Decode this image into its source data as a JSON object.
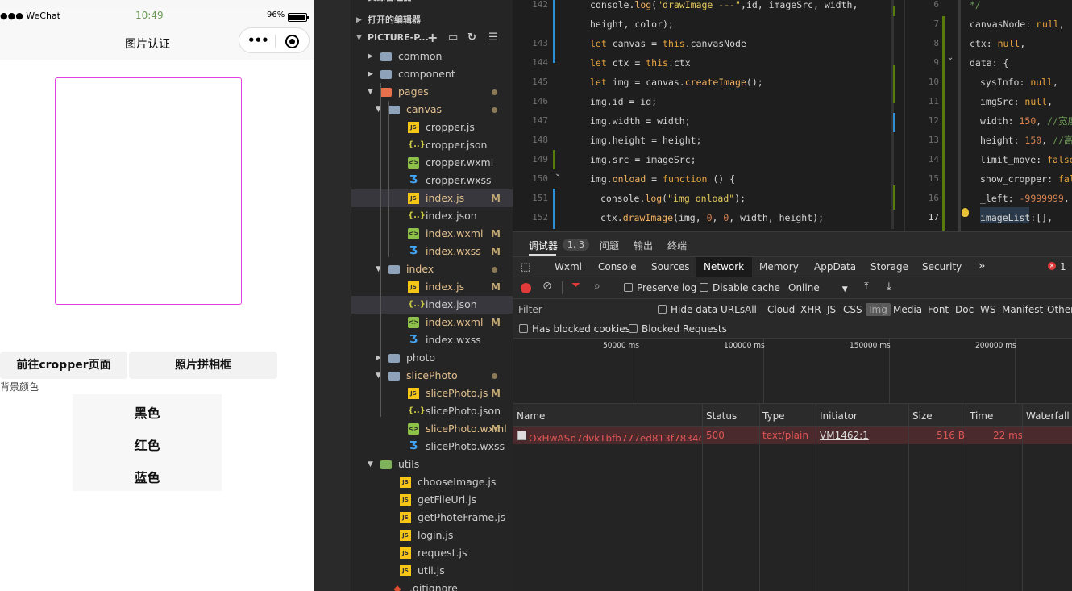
{
  "simulator": {
    "status_left": "●●● WeChat",
    "time": "10:49",
    "battery": "96%",
    "nav_title": "图片认证",
    "capsule_dots": "•••",
    "buttons": [
      "前往cropper页面",
      "照片拼相框"
    ],
    "bg_label": "背景颜色",
    "colors": [
      "黑色",
      "红色",
      "蓝色"
    ]
  },
  "explorer": {
    "header_partial": "资源管理器",
    "open_editors": "打开的编辑器",
    "project": "PICTURE-P...",
    "action_icons": [
      "add-file-icon",
      "add-folder-icon",
      "refresh-icon",
      "collapse-icon"
    ],
    "tree": [
      {
        "name": "common",
        "kind": "folder",
        "depth": 1,
        "open": false
      },
      {
        "name": "component",
        "kind": "folder",
        "depth": 1,
        "open": false
      },
      {
        "name": "pages",
        "kind": "folder-pages",
        "depth": 1,
        "open": true,
        "dot": true,
        "modified": true
      },
      {
        "name": "canvas",
        "kind": "folder",
        "depth": 2,
        "open": true,
        "dot": true,
        "modified": true
      },
      {
        "name": "cropper.js",
        "kind": "js",
        "depth": 3
      },
      {
        "name": "cropper.json",
        "kind": "json",
        "depth": 3
      },
      {
        "name": "cropper.wxml",
        "kind": "wxml",
        "depth": 3
      },
      {
        "name": "cropper.wxss",
        "kind": "wxss",
        "depth": 3
      },
      {
        "name": "index.js",
        "kind": "js",
        "depth": 3,
        "badge": "M",
        "modified": true,
        "selected": true
      },
      {
        "name": "index.json",
        "kind": "json",
        "depth": 3
      },
      {
        "name": "index.wxml",
        "kind": "wxml",
        "depth": 3,
        "badge": "M",
        "modified": true
      },
      {
        "name": "index.wxss",
        "kind": "wxss",
        "depth": 3,
        "badge": "M",
        "modified": true
      },
      {
        "name": "index",
        "kind": "folder",
        "depth": 2,
        "open": true,
        "dot": true,
        "modified": true
      },
      {
        "name": "index.js",
        "kind": "js",
        "depth": 3,
        "badge": "M",
        "modified": true
      },
      {
        "name": "index.json",
        "kind": "json",
        "depth": 3,
        "selected": true
      },
      {
        "name": "index.wxml",
        "kind": "wxml",
        "depth": 3,
        "badge": "M",
        "modified": true
      },
      {
        "name": "index.wxss",
        "kind": "wxss",
        "depth": 3
      },
      {
        "name": "photo",
        "kind": "folder",
        "depth": 2,
        "open": false
      },
      {
        "name": "slicePhoto",
        "kind": "folder",
        "depth": 2,
        "open": true,
        "dot": true,
        "modified": true
      },
      {
        "name": "slicePhoto.js",
        "kind": "js",
        "depth": 3,
        "badge": "M",
        "modified": true
      },
      {
        "name": "slicePhoto.json",
        "kind": "json",
        "depth": 3
      },
      {
        "name": "slicePhoto.wxml",
        "kind": "wxml",
        "depth": 3,
        "badge": "M",
        "modified": true
      },
      {
        "name": "slicePhoto.wxss",
        "kind": "wxss",
        "depth": 3
      },
      {
        "name": "utils",
        "kind": "folder-utils",
        "depth": 1,
        "open": true
      },
      {
        "name": "chooseImage.js",
        "kind": "js",
        "depth": 2
      },
      {
        "name": "getFileUrl.js",
        "kind": "js",
        "depth": 2
      },
      {
        "name": "getPhoteFrame.js",
        "kind": "js",
        "depth": 2
      },
      {
        "name": "login.js",
        "kind": "js",
        "depth": 2
      },
      {
        "name": "request.js",
        "kind": "js",
        "depth": 2
      },
      {
        "name": "util.js",
        "kind": "js",
        "depth": 2
      },
      {
        "name": ".gitignore",
        "kind": "git",
        "depth": 1
      }
    ]
  },
  "editor_left": {
    "lines": [
      {
        "no": "142",
        "indent": 0,
        "tokens": [
          [
            "p",
            "console."
          ],
          [
            "f",
            "log"
          ],
          [
            "p",
            "("
          ],
          [
            "s",
            "\"drawImage ---\""
          ],
          [
            "p",
            ",id, imageSrc, width,"
          ]
        ]
      },
      {
        "no": "",
        "indent": 0,
        "tokens": [
          [
            "p",
            "height, color);"
          ]
        ]
      },
      {
        "no": "143",
        "indent": 0,
        "tokens": [
          [
            "k",
            "let "
          ],
          [
            "p",
            "canvas = "
          ],
          [
            "k",
            "this"
          ],
          [
            "p",
            ".canvasNode"
          ]
        ]
      },
      {
        "no": "144",
        "indent": 0,
        "tokens": [
          [
            "k",
            "let "
          ],
          [
            "p",
            "ctx = "
          ],
          [
            "k",
            "this"
          ],
          [
            "p",
            ".ctx"
          ]
        ]
      },
      {
        "no": "145",
        "indent": 0,
        "tokens": [
          [
            "k",
            "let "
          ],
          [
            "p",
            "img = canvas."
          ],
          [
            "f",
            "createImage"
          ],
          [
            "p",
            "();"
          ]
        ]
      },
      {
        "no": "146",
        "indent": 0,
        "tokens": [
          [
            "p",
            "img.id = id;"
          ]
        ]
      },
      {
        "no": "147",
        "indent": 0,
        "tokens": [
          [
            "p",
            "img.width = width;"
          ]
        ]
      },
      {
        "no": "148",
        "indent": 0,
        "tokens": [
          [
            "p",
            "img.height = height;"
          ]
        ]
      },
      {
        "no": "149",
        "indent": 0,
        "tokens": [
          [
            "p",
            "img.src = imageSrc;"
          ]
        ]
      },
      {
        "no": "150",
        "indent": 0,
        "tokens": [
          [
            "p",
            "img."
          ],
          [
            "f",
            "onload"
          ],
          [
            "p",
            " = "
          ],
          [
            "k",
            "function "
          ],
          [
            "p",
            "() {"
          ]
        ]
      },
      {
        "no": "151",
        "indent": 1,
        "tokens": [
          [
            "p",
            "console."
          ],
          [
            "f",
            "log"
          ],
          [
            "p",
            "("
          ],
          [
            "s",
            "\"img onload\""
          ],
          [
            "p",
            ");"
          ]
        ]
      },
      {
        "no": "152",
        "indent": 1,
        "tokens": [
          [
            "p",
            "ctx."
          ],
          [
            "f",
            "drawImage"
          ],
          [
            "p",
            "(img, "
          ],
          [
            "n",
            "0"
          ],
          [
            "p",
            ", "
          ],
          [
            "n",
            "0"
          ],
          [
            "p",
            ", width, height);"
          ]
        ]
      }
    ]
  },
  "editor_right": {
    "lines": [
      {
        "no": "6",
        "indent": 0,
        "tokens": [
          [
            "c",
            "*/"
          ]
        ]
      },
      {
        "no": "7",
        "indent": 0,
        "tokens": [
          [
            "p",
            "canvasNode: "
          ],
          [
            "k",
            "null"
          ],
          [
            "p",
            ","
          ]
        ]
      },
      {
        "no": "8",
        "indent": 0,
        "tokens": [
          [
            "p",
            "ctx: "
          ],
          [
            "k",
            "null"
          ],
          [
            "p",
            ","
          ]
        ]
      },
      {
        "no": "9",
        "indent": 0,
        "tokens": [
          [
            "p",
            "data: {"
          ]
        ]
      },
      {
        "no": "10",
        "indent": 1,
        "tokens": [
          [
            "p",
            "sysInfo: "
          ],
          [
            "k",
            "null"
          ],
          [
            "p",
            ","
          ]
        ]
      },
      {
        "no": "11",
        "indent": 1,
        "tokens": [
          [
            "p",
            "imgSrc: "
          ],
          [
            "k",
            "null"
          ],
          [
            "p",
            ","
          ]
        ]
      },
      {
        "no": "12",
        "indent": 1,
        "tokens": [
          [
            "p",
            "width: "
          ],
          [
            "n",
            "150"
          ],
          [
            "p",
            ", "
          ],
          [
            "c",
            "//宽度"
          ]
        ]
      },
      {
        "no": "13",
        "indent": 1,
        "tokens": [
          [
            "p",
            "height: "
          ],
          [
            "n",
            "150"
          ],
          [
            "p",
            ", "
          ],
          [
            "c",
            "//高度"
          ]
        ]
      },
      {
        "no": "14",
        "indent": 1,
        "tokens": [
          [
            "p",
            "limit_move: "
          ],
          [
            "k",
            "false"
          ]
        ]
      },
      {
        "no": "15",
        "indent": 1,
        "tokens": [
          [
            "p",
            "show_cropper: "
          ],
          [
            "k",
            "fal"
          ]
        ]
      },
      {
        "no": "16",
        "indent": 1,
        "tokens": [
          [
            "p",
            "_left: "
          ],
          [
            "n",
            "-9999999"
          ],
          [
            "p",
            ","
          ]
        ]
      },
      {
        "no": "17",
        "indent": 1,
        "tokens": [
          [
            "p",
            "imageList:[],"
          ]
        ]
      }
    ]
  },
  "devtools": {
    "top_tabs": {
      "debugger": "调试器",
      "debugger_count": "1, 3",
      "problems": "问题",
      "output": "输出",
      "terminal": "终端"
    },
    "panel_tabs": [
      "Wxml",
      "Console",
      "Sources",
      "Network",
      "Memory",
      "AppData",
      "Storage",
      "Security"
    ],
    "active_panel": "Network",
    "more_tabs": "»",
    "error_count": "1",
    "toolbar": {
      "preserve_log": "Preserve log",
      "disable_cache": "Disable cache",
      "throttle": "Online"
    },
    "filter": {
      "placeholder": "Filter",
      "hide_data_urls": "Hide data URLs",
      "types": [
        "All",
        "Cloud",
        "XHR",
        "JS",
        "CSS",
        "Img",
        "Media",
        "Font",
        "Doc",
        "WS",
        "Manifest",
        "Other"
      ],
      "active_type": "Img",
      "has_blocked_cookies": "Has blocked cookies",
      "blocked_requests": "Blocked Requests"
    },
    "timeline_ticks": [
      "50000 ms",
      "100000 ms",
      "150000 ms",
      "200000 ms"
    ],
    "columns": [
      "Name",
      "Status",
      "Type",
      "Initiator",
      "Size",
      "Time",
      "Waterfall"
    ],
    "rows": [
      {
        "name": "QxHwASp7dvkTbfb777ed813f7834cf...",
        "status": "500",
        "type": "text/plain",
        "initiator": "VM1462:1",
        "size": "516 B",
        "time": "22 ms"
      }
    ]
  },
  "colors": {
    "accent_error": "#e03a3a",
    "canvas_border": "#e040e0",
    "modified": "#e2c08d"
  }
}
